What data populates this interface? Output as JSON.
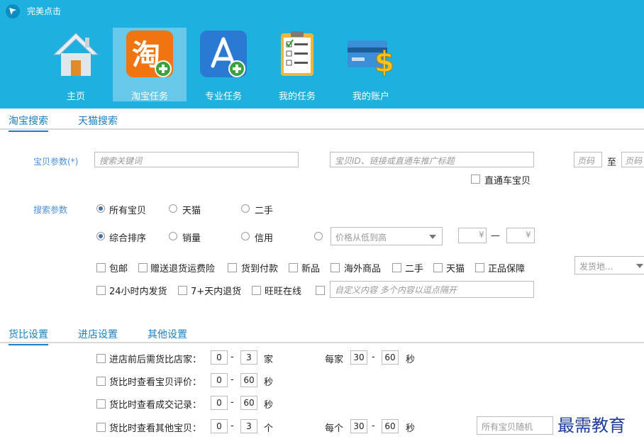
{
  "app": {
    "title": "完美点击"
  },
  "nav": [
    {
      "label": "主页",
      "icon": "home-icon"
    },
    {
      "label": "淘宝任务",
      "icon": "taobao-task-icon",
      "active": true
    },
    {
      "label": "专业任务",
      "icon": "app-store-add-icon"
    },
    {
      "label": "我的任务",
      "icon": "clipboard-checklist-icon"
    },
    {
      "label": "我的账户",
      "icon": "credit-card-dollar-icon"
    }
  ],
  "tabs1": [
    "淘宝搜索",
    "天猫搜索"
  ],
  "item_params": {
    "label": "宝贝参数(*)",
    "keyword_placeholder": "搜索关键词",
    "id_placeholder": "宝贝ID、链接或直通车推广标题",
    "page_from": "页码",
    "to": "至",
    "page_to": "页码",
    "ztc_label": "直通车宝贝"
  },
  "search_params": {
    "label": "搜索参数",
    "type_options": [
      "所有宝贝",
      "天猫",
      "二手"
    ],
    "sort_options": [
      "综合排序",
      "销量",
      "信用"
    ],
    "price_select": "价格从低到高",
    "price_min": "¥",
    "price_dash": "—",
    "price_max": "¥",
    "filters_row1": [
      "包邮",
      "赠送退货运费险",
      "货到付款",
      "新品",
      "海外商品",
      "二手",
      "天猫",
      "正品保障"
    ],
    "filters_row2": [
      "24小时内发货",
      "7+天内退货",
      "旺旺在线"
    ],
    "custom_placeholder": "自定义内容  多个内容以逗点隔开",
    "ship_from": "发货地..."
  },
  "tabs2": [
    "货比设置",
    "进店设置",
    "其他设置"
  ],
  "compare": {
    "dash": "-",
    "rows": [
      {
        "label": "进店前后需货比店家：",
        "min": "0",
        "max": "3",
        "unit": "家"
      },
      {
        "label": "货比时查看宝贝评价：",
        "min": "0",
        "max": "60",
        "unit": "秒"
      },
      {
        "label": "货比时查看成交记录：",
        "min": "0",
        "max": "60",
        "unit": "秒"
      },
      {
        "label": "货比时查看其他宝贝：",
        "min": "0",
        "max": "3",
        "unit": "个"
      }
    ],
    "per_shop": {
      "label": "每家",
      "min": "30",
      "max": "60",
      "unit": "秒"
    },
    "per_item": {
      "label": "每个",
      "min": "30",
      "max": "60",
      "unit": "秒"
    },
    "random_select": "所有宝贝随机"
  },
  "watermark": "最需教育"
}
